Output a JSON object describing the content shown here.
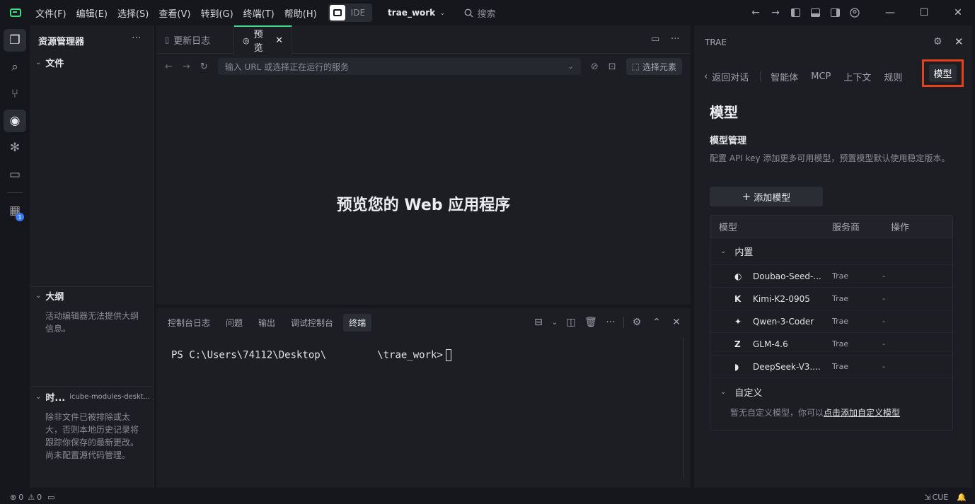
{
  "titlebar": {
    "menus": [
      "文件(F)",
      "编辑(E)",
      "选择(S)",
      "查看(V)",
      "转到(G)",
      "终端(T)",
      "帮助(H)"
    ],
    "ide_label": "IDE",
    "project": "trae_work",
    "search_placeholder": "搜索"
  },
  "explorer": {
    "title": "资源管理器",
    "files_label": "文件",
    "outline_label": "大纲",
    "outline_message": "活动编辑器无法提供大纲信息。",
    "timeline_label": "时...",
    "timeline_path": "icube-modules-deskt...",
    "timeline_message": "除非文件已被排除或太大，否则本地历史记录将跟踪你保存的最新更改。 尚未配置源代码管理。"
  },
  "editor": {
    "tabs": [
      {
        "label": "更新日志",
        "active": false
      },
      {
        "label": "预览",
        "active": true
      }
    ],
    "url_placeholder": "输入 URL 或选择正在运行的服务",
    "select_element": "选择元素",
    "preview_message": "预览您的 Web 应用程序"
  },
  "panel": {
    "tabs": [
      "控制台日志",
      "问题",
      "输出",
      "调试控制台",
      "终端"
    ],
    "active_tab": "终端",
    "terminal_prefix": "PS C:\\Users\\74112\\Desktop\\",
    "terminal_suffix": "\\trae_work>"
  },
  "right": {
    "brand": "TRAE",
    "back": "返回对话",
    "nav": [
      "智能体",
      "MCP",
      "上下文",
      "规则",
      "模型"
    ],
    "active_nav": "模型",
    "highlight_color": "#e8401c",
    "page_title": "模型",
    "section_title": "模型管理",
    "description": "配置 API key 添加更多可用模型，预置模型默认使用稳定版本。",
    "add_button": "添加模型",
    "table_headers": [
      "模型",
      "服务商",
      "操作"
    ],
    "builtin_label": "内置",
    "models": [
      {
        "name": "Doubao-Seed-...",
        "provider": "Trae",
        "action": "-",
        "icon": "doubao-icon"
      },
      {
        "name": "Kimi-K2-0905",
        "provider": "Trae",
        "action": "-",
        "icon": "kimi-icon"
      },
      {
        "name": "Qwen-3-Coder",
        "provider": "Trae",
        "action": "-",
        "icon": "qwen-icon"
      },
      {
        "name": "GLM-4.6",
        "provider": "Trae",
        "action": "-",
        "icon": "glm-icon"
      },
      {
        "name": "DeepSeek-V3....",
        "provider": "Trae",
        "action": "-",
        "icon": "deepseek-icon"
      }
    ],
    "custom_label": "自定义",
    "custom_empty_prefix": "暂无自定义模型，你可以",
    "custom_empty_link": "点击添加自定义模型"
  },
  "statusbar": {
    "errors": "0",
    "warnings": "0",
    "right_label": "CUE"
  }
}
